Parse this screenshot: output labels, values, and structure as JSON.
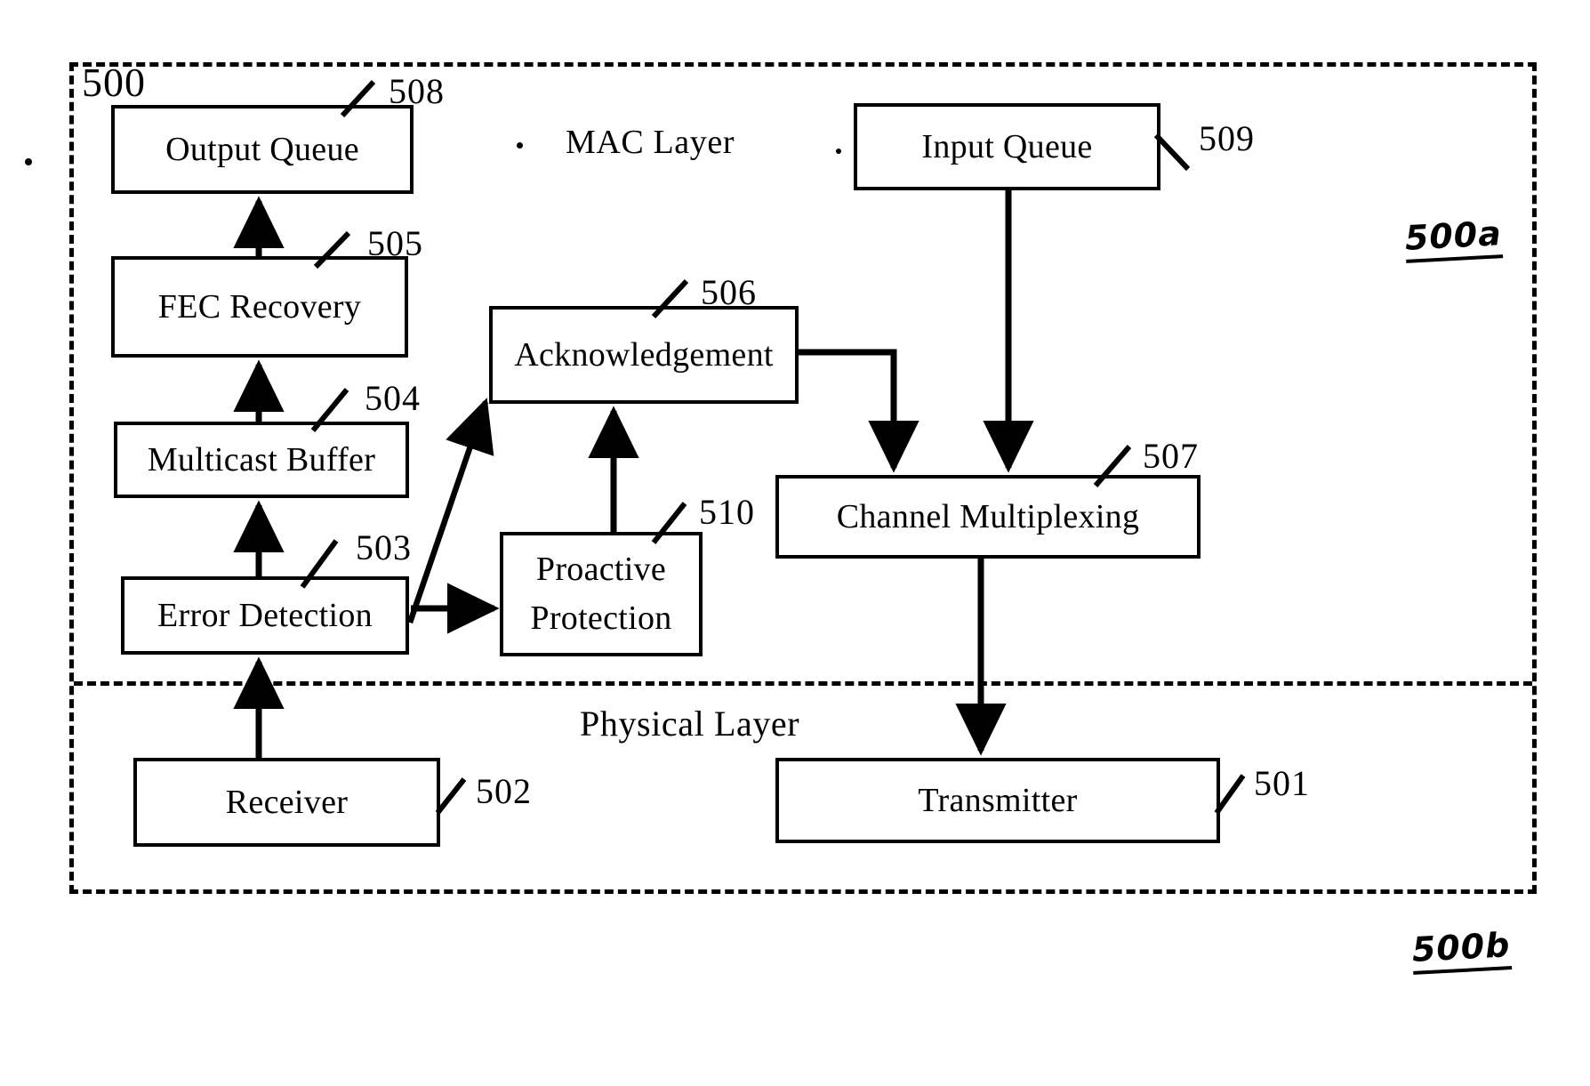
{
  "figure": {
    "outer_container_ref": "500",
    "mac_layer_title": "MAC Layer",
    "physical_layer_title": "Physical Layer",
    "handwritten_upper": "500a",
    "handwritten_lower": "500b"
  },
  "blocks": [
    {
      "id": "output_queue",
      "label": "Output Queue",
      "ref": "508"
    },
    {
      "id": "fec_recovery",
      "label": "FEC Recovery",
      "ref": "505"
    },
    {
      "id": "multicast_buffer",
      "label": "Multicast Buffer",
      "ref": "504"
    },
    {
      "id": "error_detection",
      "label": "Error Detection",
      "ref": "503"
    },
    {
      "id": "acknowledgement",
      "label": "Acknowledgement",
      "ref": "506"
    },
    {
      "id": "proactive_protection",
      "label_line1": "Proactive",
      "label_line2": "Protection",
      "ref": "510"
    },
    {
      "id": "input_queue",
      "label": "Input Queue",
      "ref": "509"
    },
    {
      "id": "channel_multiplexing",
      "label": "Channel Multiplexing",
      "ref": "507"
    },
    {
      "id": "receiver",
      "label": "Receiver",
      "ref": "502"
    },
    {
      "id": "transmitter",
      "label": "Transmitter",
      "ref": "501"
    }
  ],
  "connections": [
    {
      "from": "receiver",
      "to": "error_detection",
      "style": "vertical-up"
    },
    {
      "from": "error_detection",
      "to": "multicast_buffer",
      "style": "vertical-up"
    },
    {
      "from": "multicast_buffer",
      "to": "fec_recovery",
      "style": "vertical-up"
    },
    {
      "from": "fec_recovery",
      "to": "output_queue",
      "style": "vertical-up"
    },
    {
      "from": "error_detection",
      "to": "acknowledgement",
      "style": "diagonal-up"
    },
    {
      "from": "error_detection",
      "to": "proactive_protection",
      "style": "horizontal-right"
    },
    {
      "from": "proactive_protection",
      "to": "acknowledgement",
      "style": "vertical-up"
    },
    {
      "from": "acknowledgement",
      "to": "channel_multiplexing",
      "style": "elbow-down"
    },
    {
      "from": "input_queue",
      "to": "channel_multiplexing",
      "style": "vertical-down"
    },
    {
      "from": "channel_multiplexing",
      "to": "transmitter",
      "style": "vertical-down"
    }
  ],
  "colors": {
    "ink": "#000000",
    "paper": "#ffffff"
  }
}
